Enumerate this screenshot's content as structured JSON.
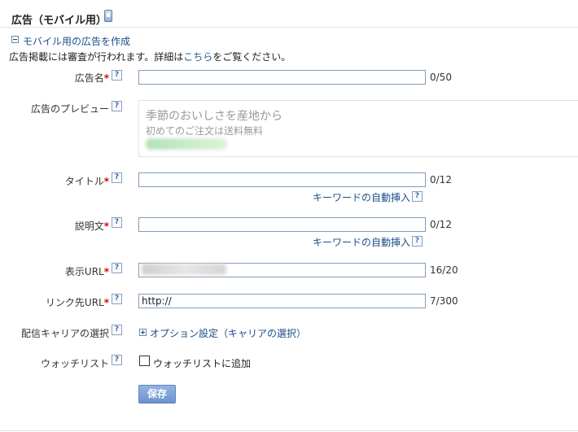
{
  "page": {
    "title": "広告（モバイル用）",
    "section_toggle": "モバイル用の広告を作成",
    "notice_before": "広告掲載には審査が行われます。詳細は",
    "notice_link": "こちら",
    "notice_after": "をご覧ください。"
  },
  "help_glyph": "?",
  "form": {
    "ad_name": {
      "label": "広告名",
      "required": "*",
      "value": "",
      "count": "0/50"
    },
    "preview": {
      "label": "広告のプレビュー",
      "line1": "季節のおいしさを産地から",
      "line2": "初めてのご注文は送料無料"
    },
    "title": {
      "label": "タイトル",
      "required": "*",
      "value": "",
      "count": "0/12",
      "keyword_link": "キーワードの自動挿入"
    },
    "description": {
      "label": "説明文",
      "required": "*",
      "value": "",
      "count": "0/12",
      "keyword_link": "キーワードの自動挿入"
    },
    "display_url": {
      "label": "表示URL",
      "required": "*",
      "count": "16/20"
    },
    "link_url": {
      "label": "リンク先URL",
      "required": "*",
      "value": "http://",
      "count": "7/300"
    },
    "carrier": {
      "label": "配信キャリアの選択",
      "option_link": "オプション設定（キャリアの選択）"
    },
    "watchlist": {
      "label": "ウォッチリスト",
      "checkbox_label": "ウォッチリストに追加",
      "checked": false
    }
  },
  "save_button": "保存",
  "colors": {
    "link": "#1a4f88",
    "required": "#dd0000",
    "button": "#6d93cf"
  }
}
